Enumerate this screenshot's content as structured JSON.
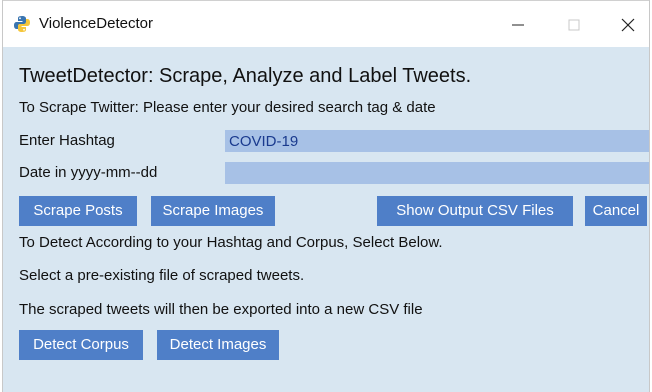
{
  "window": {
    "title": "ViolenceDetector",
    "controls": {
      "minimize": "—",
      "maximize": "☐",
      "close": "✕"
    },
    "app_icon": "python-icon"
  },
  "main": {
    "heading": "TweetDetector: Scrape, Analyze and Label Tweets.",
    "scrape_instructions": "To Scrape Twitter: Please enter your desired search tag & date",
    "hashtag_label": "Enter Hashtag",
    "hashtag_value": "COVID-19",
    "date_label": "Date in yyyy-mm--dd",
    "date_value": "",
    "buttons": {
      "scrape_posts": "Scrape Posts",
      "scrape_images": "Scrape Images",
      "show_output": "Show Output CSV Files",
      "cancel": "Cancel"
    },
    "detect_line_1": "To Detect According to your Hashtag and Corpus, Select Below.",
    "detect_line_2": "Select a pre-existing file of scraped tweets.",
    "detect_line_3": "The scraped tweets will then be exported into a new CSV file",
    "detect_buttons": {
      "detect_corpus": "Detect Corpus",
      "detect_images": "Detect Images"
    }
  },
  "colors": {
    "window_bg": "#d8e6f1",
    "button_bg": "#4f7fc8",
    "field_bg": "#a7c1e6"
  }
}
